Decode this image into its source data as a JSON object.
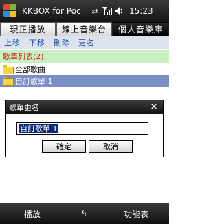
{
  "titlebar": {
    "app_title": "KKBOX for Poc",
    "time": "15:23"
  },
  "icons": {
    "start": "windows-start-icon",
    "connectivity": "sync-arrows-icon",
    "signal": "signal-strength-icon",
    "volume": "volume-icon",
    "keyboard": "keyboard-icon"
  },
  "tabs": [
    {
      "label": "現正播放",
      "active": false
    },
    {
      "label": "線上音樂台",
      "active": false
    },
    {
      "label": "個人音樂庫",
      "active": true
    }
  ],
  "toolbar": {
    "move_up": "上移",
    "move_down": "下移",
    "delete": "刪除",
    "rename": "更名"
  },
  "list": {
    "header": "歌單列表(2)",
    "items": [
      {
        "label": "全部歌曲",
        "selected": false
      },
      {
        "label": "自訂歌單 1",
        "selected": true
      }
    ]
  },
  "dialog": {
    "title": "歌單更名",
    "close": "✕",
    "input_value": "自訂歌單 1",
    "ok_label": "確定",
    "cancel_label": "取消"
  },
  "softkeys": {
    "left": "播放",
    "middle": "↰",
    "right": "功能表"
  }
}
